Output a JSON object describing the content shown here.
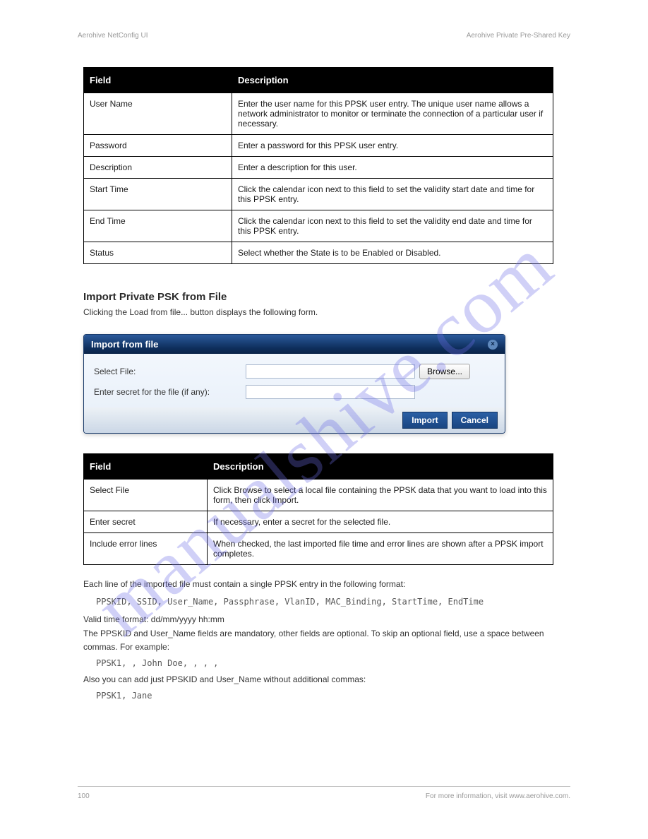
{
  "header": {
    "left": "Aerohive NetConfig UI",
    "right": "Aerohive Private Pre-Shared Key"
  },
  "watermark": "manualshive.com",
  "table1": {
    "head": {
      "col1": "Field",
      "col2": "Description"
    },
    "rows": [
      {
        "c1": "User Name",
        "c2": "Enter the user name for this PPSK user entry. The unique user name allows a network administrator to monitor or terminate the connection of a particular user if necessary."
      },
      {
        "c1": "Password",
        "c2": "Enter a password for this PPSK user entry."
      },
      {
        "c1": "Description",
        "c2": "Enter a description for this user."
      },
      {
        "c1": "Start Time",
        "c2": "Click the calendar icon next to this field to set the validity start date and time for this PPSK entry."
      },
      {
        "c1": "End Time",
        "c2": "Click the calendar icon next to this field to set the validity end date and time for this PPSK entry."
      },
      {
        "c1": "Status",
        "c2": "Select whether the State is to be Enabled or Disabled."
      }
    ]
  },
  "section": {
    "title": "Import Private PSK from File",
    "subtitle": "Clicking the Load from file... button displays the following form.",
    "after_dialog": "Each line of the imported file must contain a single PPSK entry in the following format:"
  },
  "dialog": {
    "title": "Import from file",
    "select_file_label": "Select File:",
    "secret_label": "Enter secret for the file (if any):",
    "browse_label": "Browse...",
    "import_label": "Import",
    "cancel_label": "Cancel"
  },
  "table2": {
    "head": {
      "col1": "Field",
      "col2": "Description"
    },
    "rows": [
      {
        "c1": "Select File",
        "c2": "Click Browse to select a local file containing the PPSK data that you want to load into this form, then click Import."
      },
      {
        "c1": "Enter secret",
        "c2": "If necessary, enter a secret for the selected file."
      },
      {
        "c1": "Include error lines",
        "c2": "When checked, the last imported file time and error lines are shown after a PPSK import completes."
      }
    ]
  },
  "ppsk_format": {
    "intro": "Each line of the imported file must contain a single PPSK entry in the following format:",
    "format_line": "PPSKID, SSID, User_Name, Passphrase, VlanID, MAC_Binding, StartTime, EndTime",
    "valid_time_line": "Valid time format: dd/mm/yyyy hh:mm",
    "optional_line": "The PPSKID and User_Name fields are mandatory, other fields are optional. To skip an optional field, use a space between commas. For example:",
    "example_line1": "PPSK1, , John Doe, , , ,",
    "second_example_intro": "Also you can add just PPSKID and User_Name without additional commas:",
    "example_line2": "PPSK1, Jane"
  },
  "footer": {
    "left": "100",
    "right": "For more information, visit www.aerohive.com."
  }
}
